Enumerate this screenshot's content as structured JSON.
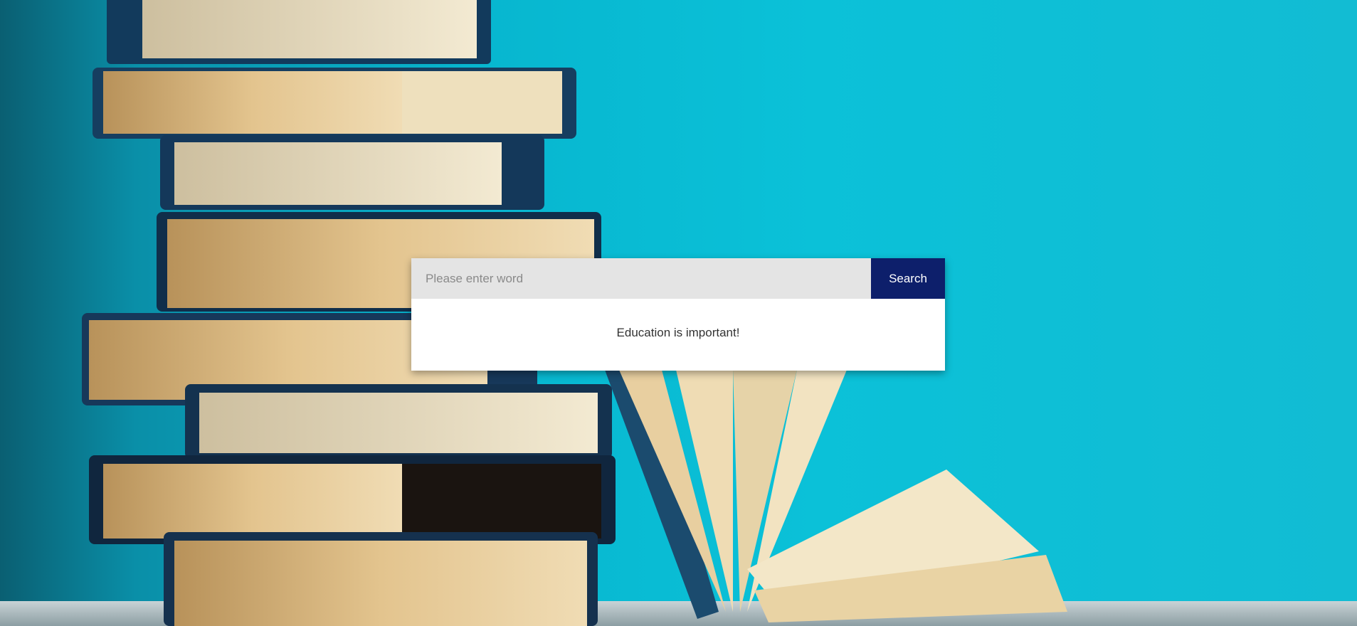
{
  "search": {
    "placeholder": "Please enter word",
    "value": "",
    "button_label": "Search"
  },
  "message": "Education is important!",
  "colors": {
    "background": "#0bc1d8",
    "search_button": "#0d1f6b",
    "input_background": "#e4e4e4",
    "card_background": "#ffffff"
  },
  "background_image": "books-stack-icon"
}
